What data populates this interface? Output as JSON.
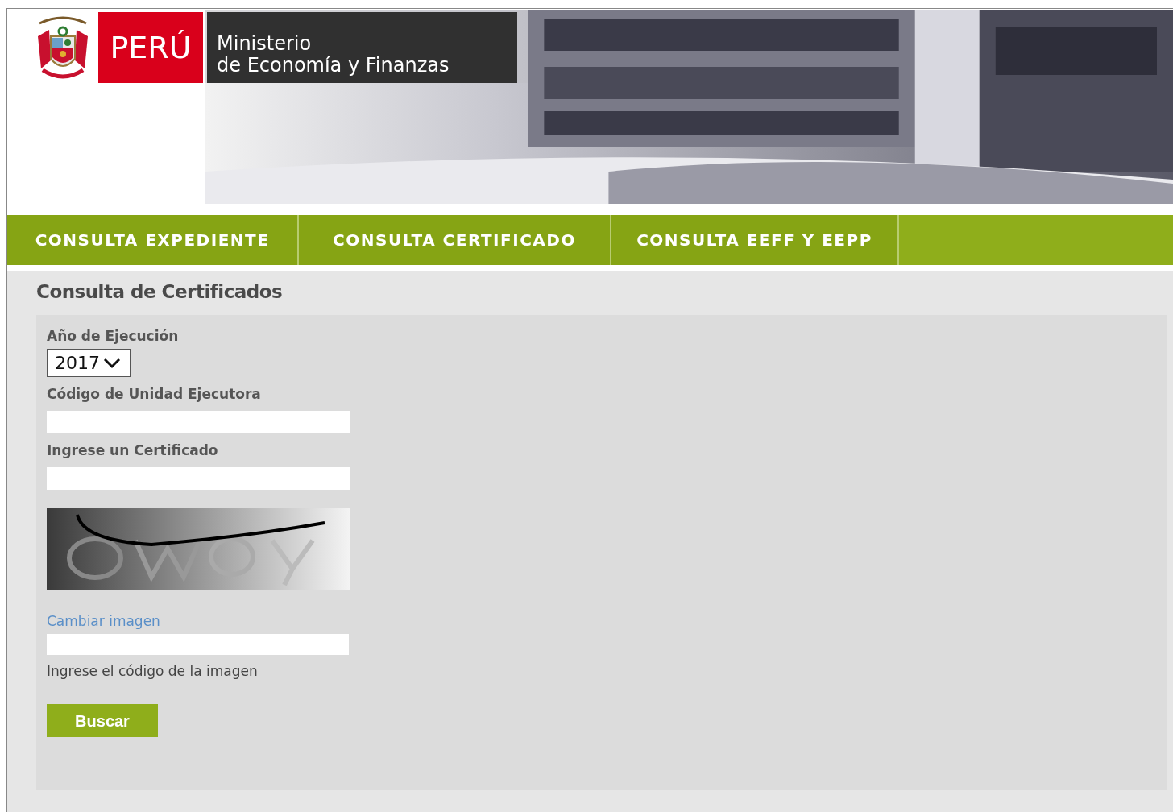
{
  "header": {
    "country": "PERÚ",
    "ministry_line_1": "Ministerio",
    "ministry_line_2": "de Economía y Finanzas"
  },
  "nav": [
    {
      "label": "CONSULTA EXPEDIENTE"
    },
    {
      "label": "CONSULTA CERTIFICADO"
    },
    {
      "label": "CONSULTA EEFF Y EEPP"
    }
  ],
  "page_title": "Consulta de Certificados",
  "form": {
    "year_label": "Año de Ejecución",
    "year_value": "2017",
    "unit_label": "Código de Unidad Ejecutora",
    "certificate_label": "Ingrese un Certificado",
    "change_image_link": "Cambiar imagen",
    "captcha_hint": "Ingrese el código de la imagen",
    "submit": "Buscar"
  }
}
